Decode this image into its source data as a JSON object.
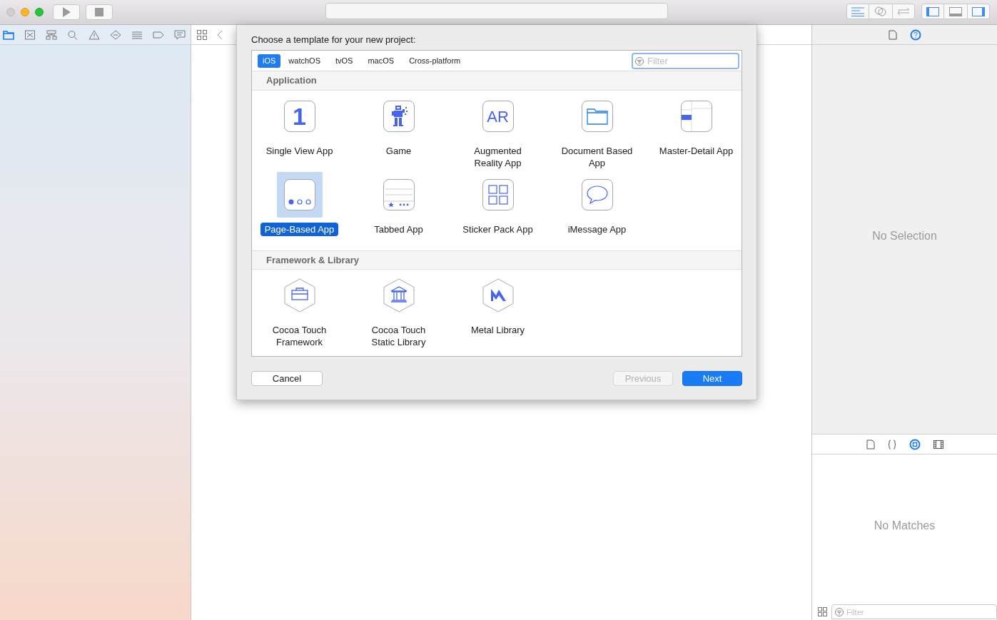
{
  "dialog": {
    "title": "Choose a template for your new project:",
    "tabs": [
      {
        "label": "iOS",
        "selected": true
      },
      {
        "label": "watchOS",
        "selected": false
      },
      {
        "label": "tvOS",
        "selected": false
      },
      {
        "label": "macOS",
        "selected": false
      },
      {
        "label": "Cross-platform",
        "selected": false
      }
    ],
    "filter": {
      "placeholder": "Filter"
    },
    "sections": [
      {
        "title": "Application",
        "kind": "app",
        "items": [
          {
            "label": "Single View App",
            "selected": false,
            "glyph": "1"
          },
          {
            "label": "Game",
            "selected": false
          },
          {
            "label": "Augmented\nReality App",
            "selected": false,
            "glyph": "AR"
          },
          {
            "label": "Document Based\nApp",
            "selected": false
          },
          {
            "label": "Master-Detail App",
            "selected": false
          },
          {
            "label": "Page-Based App",
            "selected": true
          },
          {
            "label": "Tabbed App",
            "selected": false
          },
          {
            "label": "Sticker Pack App",
            "selected": false
          },
          {
            "label": "iMessage App",
            "selected": false
          }
        ]
      },
      {
        "title": "Framework & Library",
        "kind": "library",
        "items": [
          {
            "label": "Cocoa Touch\nFramework",
            "selected": false
          },
          {
            "label": "Cocoa Touch\nStatic Library",
            "selected": false
          },
          {
            "label": "Metal Library",
            "selected": false
          }
        ]
      }
    ],
    "buttons": [
      {
        "label": "Cancel",
        "disabled": false,
        "primary": false
      },
      {
        "label": "Previous",
        "disabled": true,
        "primary": false
      },
      {
        "label": "Next",
        "disabled": false,
        "primary": true
      }
    ]
  },
  "inspector": {
    "message": "No Selection"
  },
  "library": {
    "message": "No Matches",
    "filter": {
      "placeholder": "Filter"
    }
  }
}
